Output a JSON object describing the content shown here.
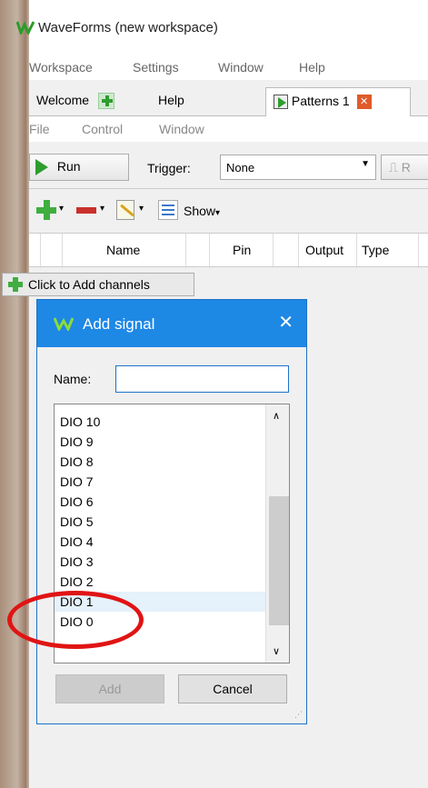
{
  "app": {
    "title": "WaveForms (new workspace)"
  },
  "menu": {
    "items": [
      "Workspace",
      "Settings",
      "Window",
      "Help"
    ]
  },
  "tabs": [
    {
      "label": "Welcome"
    },
    {
      "label": "Help"
    },
    {
      "label": "Patterns 1"
    }
  ],
  "submenu": {
    "items": [
      "File",
      "Control",
      "Window"
    ]
  },
  "toolbar": {
    "run_label": "Run",
    "trigger_label": "Trigger:",
    "trigger_value": "None",
    "cut_label": "R",
    "show_label": "Show"
  },
  "grid": {
    "headers": [
      "Name",
      "Pin",
      "Output",
      "Type"
    ]
  },
  "add_channels_label": "Click to Add channels",
  "dialog": {
    "title": "Add signal",
    "name_label": "Name:",
    "name_value": "",
    "items": [
      "DIO 10",
      "DIO 9",
      "DIO 8",
      "DIO 7",
      "DIO 6",
      "DIO 5",
      "DIO 4",
      "DIO 3",
      "DIO 2",
      "DIO 1",
      "DIO 0"
    ],
    "selected_index": 9,
    "add_label": "Add",
    "cancel_label": "Cancel"
  }
}
